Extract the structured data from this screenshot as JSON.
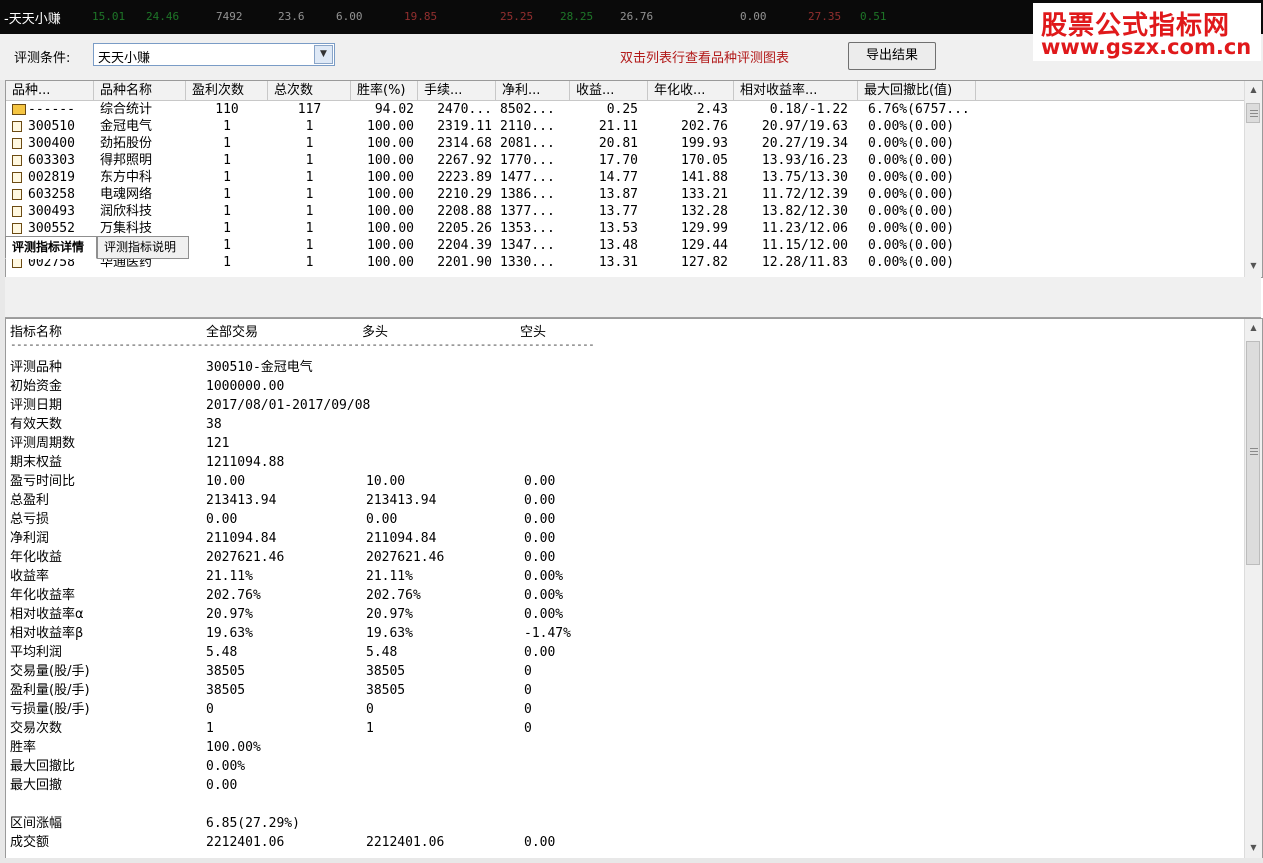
{
  "window": {
    "title": "-天天小赚"
  },
  "ticker_values": [
    "15.01",
    "24.46",
    "7492",
    "23.6",
    "6.00",
    "19.85",
    "25.25",
    "28.25",
    "26.76",
    "0.00",
    "27.35",
    "0.51"
  ],
  "watermark": {
    "line1": "股票公式指标网",
    "line2": "www.gszx.com.cn"
  },
  "toolbar": {
    "condition_label": "评测条件:",
    "condition_value": "天天小赚",
    "hint": "双击列表行查看品种评测图表",
    "export_button": "导出结果"
  },
  "grid": {
    "columns": [
      "品种...",
      "品种名称",
      "盈利次数",
      "总次数",
      "胜率(%)",
      "手续...",
      "净利...",
      "收益...",
      "年化收...",
      "相对收益率...",
      "最大回撤比(值)"
    ],
    "rows": [
      {
        "code": "------",
        "name": "综合统计",
        "wins": "110",
        "total": "117",
        "winrate": "94.02",
        "fee": "2470...",
        "net": "8502...",
        "ret": "0.25",
        "annual": "2.43",
        "rel": "0.18/-1.22",
        "dd": "6.76%(6757...",
        "summary": true
      },
      {
        "code": "300510",
        "name": "金冠电气",
        "wins": "1",
        "total": "1",
        "winrate": "100.00",
        "fee": "2319.11",
        "net": "2110...",
        "ret": "21.11",
        "annual": "202.76",
        "rel": "20.97/19.63",
        "dd": "0.00%(0.00)"
      },
      {
        "code": "300400",
        "name": "劲拓股份",
        "wins": "1",
        "total": "1",
        "winrate": "100.00",
        "fee": "2314.68",
        "net": "2081...",
        "ret": "20.81",
        "annual": "199.93",
        "rel": "20.27/19.34",
        "dd": "0.00%(0.00)"
      },
      {
        "code": "603303",
        "name": "得邦照明",
        "wins": "1",
        "total": "1",
        "winrate": "100.00",
        "fee": "2267.92",
        "net": "1770...",
        "ret": "17.70",
        "annual": "170.05",
        "rel": "13.93/16.23",
        "dd": "0.00%(0.00)"
      },
      {
        "code": "002819",
        "name": "东方中科",
        "wins": "1",
        "total": "1",
        "winrate": "100.00",
        "fee": "2223.89",
        "net": "1477...",
        "ret": "14.77",
        "annual": "141.88",
        "rel": "13.75/13.30",
        "dd": "0.00%(0.00)"
      },
      {
        "code": "603258",
        "name": "电魂网络",
        "wins": "1",
        "total": "1",
        "winrate": "100.00",
        "fee": "2210.29",
        "net": "1386...",
        "ret": "13.87",
        "annual": "133.21",
        "rel": "11.72/12.39",
        "dd": "0.00%(0.00)"
      },
      {
        "code": "300493",
        "name": "润欣科技",
        "wins": "1",
        "total": "1",
        "winrate": "100.00",
        "fee": "2208.88",
        "net": "1377...",
        "ret": "13.77",
        "annual": "132.28",
        "rel": "13.82/12.30",
        "dd": "0.00%(0.00)"
      },
      {
        "code": "300552",
        "name": "万集科技",
        "wins": "1",
        "total": "1",
        "winrate": "100.00",
        "fee": "2205.26",
        "net": "1353...",
        "ret": "13.53",
        "annual": "129.99",
        "rel": "11.23/12.06",
        "dd": "0.00%(0.00)"
      },
      {
        "code": "",
        "name": "",
        "wins": "1",
        "total": "1",
        "winrate": "100.00",
        "fee": "2204.39",
        "net": "1347...",
        "ret": "13.48",
        "annual": "129.44",
        "rel": "11.15/12.00",
        "dd": "0.00%(0.00)"
      },
      {
        "code": "002758",
        "name": "华通医药",
        "wins": "1",
        "total": "1",
        "winrate": "100.00",
        "fee": "2201.90",
        "net": "1330...",
        "ret": "13.31",
        "annual": "127.82",
        "rel": "12.28/11.83",
        "dd": "0.00%(0.00)"
      }
    ]
  },
  "tabs": [
    "评测指标详情",
    "评测指标说明"
  ],
  "detail": {
    "headers": [
      "指标名称",
      "全部交易",
      "多头",
      "空头"
    ],
    "divider": "------------------------------------------------------------------------------------------------------------------",
    "rows": [
      {
        "name": "评测品种",
        "all": "300510-金冠电气",
        "long": "",
        "short": ""
      },
      {
        "name": "初始资金",
        "all": "1000000.00",
        "long": "",
        "short": ""
      },
      {
        "name": "评测日期",
        "all": "2017/08/01-2017/09/08",
        "long": "",
        "short": ""
      },
      {
        "name": "有效天数",
        "all": "38",
        "long": "",
        "short": ""
      },
      {
        "name": "评测周期数",
        "all": "121",
        "long": "",
        "short": ""
      },
      {
        "name": "期末权益",
        "all": "1211094.88",
        "long": "",
        "short": ""
      },
      {
        "name": "盈亏时间比",
        "all": "10.00",
        "long": "10.00",
        "short": "0.00"
      },
      {
        "name": "总盈利",
        "all": "213413.94",
        "long": "213413.94",
        "short": "0.00"
      },
      {
        "name": "总亏损",
        "all": "0.00",
        "long": "0.00",
        "short": "0.00"
      },
      {
        "name": "净利润",
        "all": "211094.84",
        "long": "211094.84",
        "short": "0.00"
      },
      {
        "name": "年化收益",
        "all": "2027621.46",
        "long": "2027621.46",
        "short": "0.00"
      },
      {
        "name": "收益率",
        "all": "21.11%",
        "long": "21.11%",
        "short": "0.00%"
      },
      {
        "name": "年化收益率",
        "all": "202.76%",
        "long": "202.76%",
        "short": "0.00%"
      },
      {
        "name": "相对收益率α",
        "all": "20.97%",
        "long": "20.97%",
        "short": "0.00%"
      },
      {
        "name": "相对收益率β",
        "all": "19.63%",
        "long": "19.63%",
        "short": "-1.47%"
      },
      {
        "name": "平均利润",
        "all": "5.48",
        "long": "5.48",
        "short": "0.00"
      },
      {
        "name": "交易量(股/手)",
        "all": "38505",
        "long": "38505",
        "short": "0"
      },
      {
        "name": "盈利量(股/手)",
        "all": "38505",
        "long": "38505",
        "short": "0"
      },
      {
        "name": "亏损量(股/手)",
        "all": "0",
        "long": "0",
        "short": "0"
      },
      {
        "name": "交易次数",
        "all": "1",
        "long": "1",
        "short": "0"
      },
      {
        "name": "胜率",
        "all": "100.00%",
        "long": "",
        "short": ""
      },
      {
        "name": "最大回撤比",
        "all": "0.00%",
        "long": "",
        "short": ""
      },
      {
        "name": "最大回撤",
        "all": "0.00",
        "long": "",
        "short": ""
      },
      {
        "name": "",
        "all": "",
        "long": "",
        "short": ""
      },
      {
        "name": "区间涨幅",
        "all": "6.85(27.29%)",
        "long": "",
        "short": ""
      },
      {
        "name": "成交额",
        "all": "2212401.06",
        "long": "2212401.06",
        "short": "0.00"
      }
    ]
  },
  "colors": {
    "hint": "#b21818",
    "watermark": "#e0191b",
    "summary_icon": "#f5c542"
  },
  "icons": {
    "combo_arrow": "chevron-down-icon",
    "row": "file-icon",
    "summary": "folder-icon"
  }
}
